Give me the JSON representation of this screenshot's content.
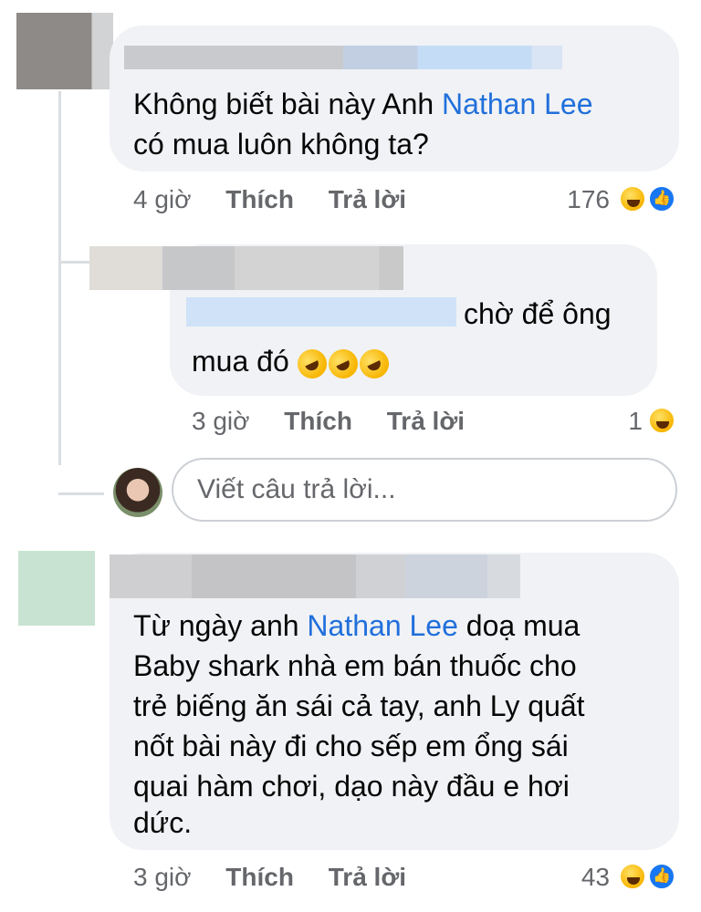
{
  "comments": [
    {
      "text_lines": [
        {
          "before": "Không biết bài này Anh ",
          "mention": "Nathan Lee",
          "after": ""
        },
        {
          "before": "có mua luôn không ta?",
          "mention": "",
          "after": ""
        }
      ],
      "time": "4 giờ",
      "like_label": "Thích",
      "reply_label": "Trả lời",
      "reaction_count": "176",
      "reactions": [
        "haha-icon",
        "like-icon"
      ]
    },
    {
      "text_lines": [
        {
          "before": "chờ để ông",
          "mention": "",
          "after": ""
        },
        {
          "before": "mua đó",
          "mention": "",
          "after": ""
        }
      ],
      "emojis": [
        "rofl-emoji",
        "rofl-emoji",
        "rofl-emoji"
      ],
      "time": "3 giờ",
      "like_label": "Thích",
      "reply_label": "Trả lời",
      "reaction_count": "1",
      "reactions": [
        "haha-icon"
      ]
    },
    {
      "text_lines": [
        {
          "before": "Từ ngày anh ",
          "mention": "Nathan Lee",
          "after": " doạ mua"
        },
        {
          "before": "Baby shark nhà em bán thuốc cho",
          "mention": "",
          "after": ""
        },
        {
          "before": "trẻ biếng ăn sái cả tay, anh Ly quất",
          "mention": "",
          "after": ""
        },
        {
          "before": "nốt bài này đi cho sếp em ổng sái",
          "mention": "",
          "after": ""
        },
        {
          "before": "quai hàm chơi, dạo này đầu e hơi",
          "mention": "",
          "after": ""
        },
        {
          "before": "dức.",
          "mention": "",
          "after": ""
        }
      ],
      "time": "3 giờ",
      "like_label": "Thích",
      "reply_label": "Trả lời",
      "reaction_count": "43",
      "reactions": [
        "haha-icon",
        "like-icon"
      ]
    }
  ],
  "reply_input": {
    "placeholder": "Viết câu trả lời..."
  },
  "colors": {
    "bubble": "#f0f2f5",
    "mention": "#216fdb",
    "meta": "#65676b",
    "like": "#1877f2"
  }
}
